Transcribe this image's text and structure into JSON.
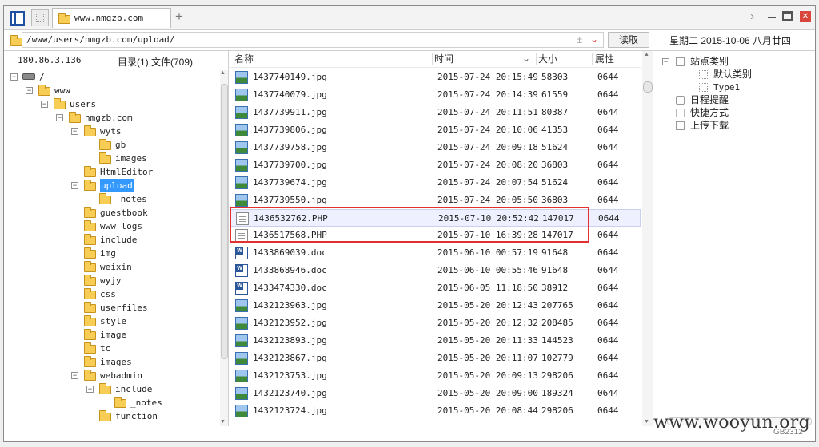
{
  "tab": {
    "title": "www.nmgzb.com"
  },
  "address": {
    "path": "/www/users/nmgzb.com/upload/",
    "read_button": "读取"
  },
  "date_bar": {
    "text": "星期二  2015-10-06  八月廿四"
  },
  "left_panel": {
    "ip": "180.86.3.136",
    "summary": "目录(1),文件(709)",
    "tree": [
      {
        "label": "/",
        "depth": 0,
        "toggle": "⊟",
        "icon": "drive"
      },
      {
        "label": "www",
        "depth": 1,
        "toggle": "⊟",
        "icon": "folder"
      },
      {
        "label": "users",
        "depth": 2,
        "toggle": "⊟",
        "icon": "folder"
      },
      {
        "label": "nmgzb.com",
        "depth": 3,
        "toggle": "⊟",
        "icon": "folder"
      },
      {
        "label": "wyts",
        "depth": 4,
        "toggle": "⊟",
        "icon": "folder"
      },
      {
        "label": "gb",
        "depth": 5,
        "toggle": "",
        "icon": "folder"
      },
      {
        "label": "images",
        "depth": 5,
        "toggle": "",
        "icon": "folder"
      },
      {
        "label": "HtmlEditor",
        "depth": 4,
        "toggle": "",
        "icon": "folder"
      },
      {
        "label": "upload",
        "depth": 4,
        "toggle": "⊟",
        "icon": "folder",
        "selected": true
      },
      {
        "label": "_notes",
        "depth": 5,
        "toggle": "",
        "icon": "folder"
      },
      {
        "label": "guestbook",
        "depth": 4,
        "toggle": "",
        "icon": "folder"
      },
      {
        "label": "www_logs",
        "depth": 4,
        "toggle": "",
        "icon": "folder"
      },
      {
        "label": "include",
        "depth": 4,
        "toggle": "",
        "icon": "folder"
      },
      {
        "label": "img",
        "depth": 4,
        "toggle": "",
        "icon": "folder"
      },
      {
        "label": "weixin",
        "depth": 4,
        "toggle": "",
        "icon": "folder"
      },
      {
        "label": "wyjy",
        "depth": 4,
        "toggle": "",
        "icon": "folder"
      },
      {
        "label": "css",
        "depth": 4,
        "toggle": "",
        "icon": "folder"
      },
      {
        "label": "userfiles",
        "depth": 4,
        "toggle": "",
        "icon": "folder"
      },
      {
        "label": "style",
        "depth": 4,
        "toggle": "",
        "icon": "folder"
      },
      {
        "label": "image",
        "depth": 4,
        "toggle": "",
        "icon": "folder"
      },
      {
        "label": "tc",
        "depth": 4,
        "toggle": "",
        "icon": "folder"
      },
      {
        "label": "images",
        "depth": 4,
        "toggle": "",
        "icon": "folder"
      },
      {
        "label": "webadmin",
        "depth": 4,
        "toggle": "⊟",
        "icon": "folder"
      },
      {
        "label": "include",
        "depth": 5,
        "toggle": "⊟",
        "icon": "folder"
      },
      {
        "label": "_notes",
        "depth": 6,
        "toggle": "",
        "icon": "folder"
      },
      {
        "label": "function",
        "depth": 5,
        "toggle": "",
        "icon": "folder"
      }
    ]
  },
  "file_list": {
    "headers": {
      "name": "名称",
      "time": "时间",
      "size": "大小",
      "attr": "属性"
    },
    "rows": [
      {
        "name": "1437740149.jpg",
        "time": "2015-07-24 20:15:49",
        "size": "58303",
        "attr": "0644",
        "type": "image"
      },
      {
        "name": "1437740079.jpg",
        "time": "2015-07-24 20:14:39",
        "size": "61559",
        "attr": "0644",
        "type": "image"
      },
      {
        "name": "1437739911.jpg",
        "time": "2015-07-24 20:11:51",
        "size": "80387",
        "attr": "0644",
        "type": "image"
      },
      {
        "name": "1437739806.jpg",
        "time": "2015-07-24 20:10:06",
        "size": "41353",
        "attr": "0644",
        "type": "image"
      },
      {
        "name": "1437739758.jpg",
        "time": "2015-07-24 20:09:18",
        "size": "51624",
        "attr": "0644",
        "type": "image"
      },
      {
        "name": "1437739700.jpg",
        "time": "2015-07-24 20:08:20",
        "size": "36803",
        "attr": "0644",
        "type": "image"
      },
      {
        "name": "1437739674.jpg",
        "time": "2015-07-24 20:07:54",
        "size": "51624",
        "attr": "0644",
        "type": "image"
      },
      {
        "name": "1437739550.jpg",
        "time": "2015-07-24 20:05:50",
        "size": "36803",
        "attr": "0644",
        "type": "image"
      },
      {
        "name": "1436532762.PHP",
        "time": "2015-07-10 20:52:42",
        "size": "147017",
        "attr": "0644",
        "type": "php",
        "selected": true
      },
      {
        "name": "1436517568.PHP",
        "time": "2015-07-10 16:39:28",
        "size": "147017",
        "attr": "0644",
        "type": "php"
      },
      {
        "name": "1433869039.doc",
        "time": "2015-06-10 00:57:19",
        "size": "91648",
        "attr": "0644",
        "type": "doc"
      },
      {
        "name": "1433868946.doc",
        "time": "2015-06-10 00:55:46",
        "size": "91648",
        "attr": "0644",
        "type": "doc"
      },
      {
        "name": "1433474330.doc",
        "time": "2015-06-05 11:18:50",
        "size": "38912",
        "attr": "0644",
        "type": "doc"
      },
      {
        "name": "1432123963.jpg",
        "time": "2015-05-20 20:12:43",
        "size": "207765",
        "attr": "0644",
        "type": "image"
      },
      {
        "name": "1432123952.jpg",
        "time": "2015-05-20 20:12:32",
        "size": "208485",
        "attr": "0644",
        "type": "image"
      },
      {
        "name": "1432123893.jpg",
        "time": "2015-05-20 20:11:33",
        "size": "144523",
        "attr": "0644",
        "type": "image"
      },
      {
        "name": "1432123867.jpg",
        "time": "2015-05-20 20:11:07",
        "size": "102779",
        "attr": "0644",
        "type": "image"
      },
      {
        "name": "1432123753.jpg",
        "time": "2015-05-20 20:09:13",
        "size": "298206",
        "attr": "0644",
        "type": "image"
      },
      {
        "name": "1432123740.jpg",
        "time": "2015-05-20 20:09:00",
        "size": "189324",
        "attr": "0644",
        "type": "image"
      },
      {
        "name": "1432123724.jpg",
        "time": "2015-05-20 20:08:44",
        "size": "298206",
        "attr": "0644",
        "type": "image"
      }
    ]
  },
  "right_panel": {
    "items": [
      {
        "label": "站点类别",
        "depth": 0,
        "toggle": "⊟",
        "icon": "box"
      },
      {
        "label": "默认类别",
        "depth": 1,
        "toggle": "",
        "icon": "dotted"
      },
      {
        "label": "Type1",
        "depth": 1,
        "toggle": "",
        "icon": "dotted"
      },
      {
        "label": "日程提醒",
        "depth": 0,
        "toggle": "",
        "icon": "clock"
      },
      {
        "label": "快捷方式",
        "depth": 0,
        "toggle": "",
        "icon": "hand"
      },
      {
        "label": "上传下载",
        "depth": 0,
        "toggle": "",
        "icon": "box"
      }
    ]
  },
  "watermark": {
    "text": "www.wooyun.org",
    "encoding": "GB2312"
  },
  "colors": {
    "selection": "#3399ff",
    "highlight_border": "#e23030",
    "row_highlight": "#eef0ff"
  }
}
